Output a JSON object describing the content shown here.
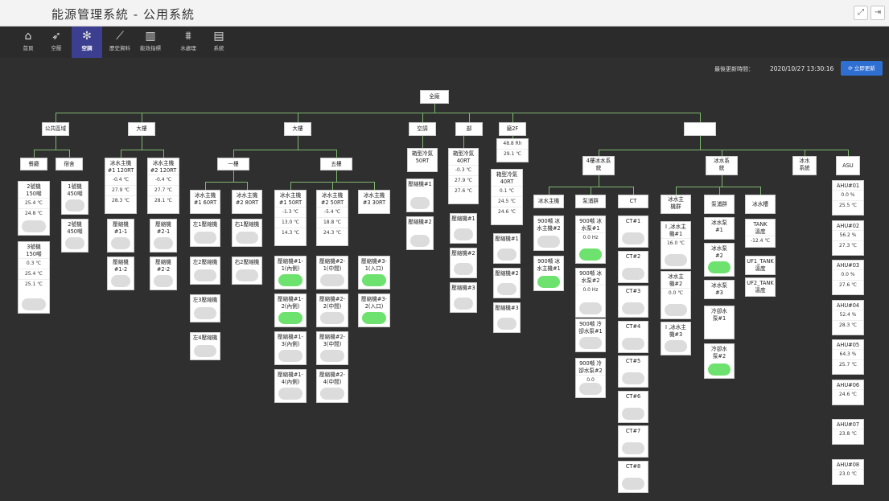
{
  "app": {
    "title": "能源管理系統 - 公用系統",
    "expand_icon": "expand-icon",
    "exit_icon": "exit-icon"
  },
  "nav": [
    {
      "label": "首頁",
      "icon": "home-icon"
    },
    {
      "label": "空壓",
      "icon": "rocket-icon"
    },
    {
      "label": "空調",
      "icon": "snowflake-icon"
    },
    {
      "label": "歷史資料",
      "icon": "line-chart-icon"
    },
    {
      "label": "能效指標",
      "icon": "bar-chart-icon"
    },
    {
      "label": "水處理",
      "icon": "water-plant-icon"
    },
    {
      "label": "系統",
      "icon": "document-icon"
    }
  ],
  "status": {
    "last_update_label": "最後更新時間：",
    "last_update_time": "2020/10/27 13:30:16",
    "refresh_label": "立即更新",
    "refresh_icon": "refresh-icon"
  },
  "colors": {
    "active_tab": "#3c3f8f",
    "on_state": "#6ee26e",
    "off_state": "#dcdcdc",
    "connector": "#7fb870",
    "refresh_button": "#2f6fd1"
  },
  "tree": {
    "root": "全廠",
    "lvl1": [
      "公共區域",
      "大樓",
      "大樓",
      "空調",
      "部",
      "廠2F",
      ""
    ],
    "public": [
      "餐廳",
      "宿舍"
    ],
    "canteen": [
      {
        "title": "2號機\n150噸",
        "vals": [
          "25.4 ℃",
          "24.8 ℃"
        ],
        "state": "off"
      },
      {
        "title": "3號機\n150噸",
        "vals": [
          "0.3 ℃",
          "25.4 ℃",
          "25.1 ℃"
        ],
        "state": "off"
      }
    ],
    "dorm": [
      {
        "title": "1號機\n450噸",
        "vals": [],
        "state": "off"
      },
      {
        "title": "2號機\n450噸",
        "vals": [],
        "state": "off"
      }
    ],
    "bldg1_chillers": [
      {
        "title": "冰水主機\n#1 120RT",
        "vals": [
          "-0.4 ℃",
          "27.9 ℃",
          "28.3 ℃"
        ]
      },
      {
        "title": "冰水主機\n#2 120RT",
        "vals": [
          "-0.4 ℃",
          "27.7 ℃",
          "28.1 ℃"
        ]
      }
    ],
    "bldg1_comp": [
      [
        "壓縮機\n#1-1",
        "壓縮機\n#1-2"
      ],
      [
        "壓縮機\n#2-1",
        "壓縮機\n#2-2"
      ]
    ],
    "bldg2_groups": [
      "一樓",
      "五樓"
    ],
    "floor1_chillers": [
      {
        "title": "冰水主機\n#1 60RT"
      },
      {
        "title": "冰水主機\n#2 80RT"
      }
    ],
    "floor1_comp": [
      [
        "左1壓縮機",
        "左2壓縮機",
        "左3壓縮機",
        "左4壓縮機"
      ],
      [
        "右1壓縮機",
        "右2壓縮機"
      ]
    ],
    "floor5_chillers": [
      {
        "title": "冰水主機\n#1 50RT",
        "vals": [
          "-1.3 ℃",
          "13.0 ℃",
          "14.3 ℃"
        ]
      },
      {
        "title": "冰水主機\n#2 50RT",
        "vals": [
          "-5.4 ℃",
          "18.8 ℃",
          "24.3 ℃"
        ]
      },
      {
        "title": "冰水主機\n#3 30RT",
        "vals": []
      }
    ],
    "floor5_comp": [
      [
        {
          "title": "壓縮機#1-\n1(內側)",
          "state": "on"
        },
        {
          "title": "壓縮機#1-\n2(內側)",
          "state": "on"
        },
        {
          "title": "壓縮機#1-\n3(內側)",
          "state": "off"
        },
        {
          "title": "壓縮機#1-\n4(內側)",
          "state": "off"
        }
      ],
      [
        {
          "title": "壓縮機#2-\n1(中間)",
          "state": "off"
        },
        {
          "title": "壓縮機#2-\n2(中間)",
          "state": "off"
        },
        {
          "title": "壓縮機#2-\n3(中間)",
          "state": "off"
        },
        {
          "title": "壓縮機#2-\n4(中間)",
          "state": "off"
        }
      ],
      [
        {
          "title": "壓縮機#3-\n1(入口)",
          "state": "on"
        },
        {
          "title": "壓縮機#3-\n2(入口)",
          "state": "on"
        }
      ]
    ],
    "ac": {
      "title": "箱型冷氣\n50RT",
      "comps": [
        "壓縮機#1",
        "壓縮機#2"
      ]
    },
    "dept": {
      "title": "箱型冷氣\n40RT",
      "vals": [
        "-0.3 ℃",
        "27.9 ℃",
        "27.6 ℃"
      ],
      "comps": [
        "壓縮機#1",
        "壓縮機#2",
        "壓縮機#3"
      ]
    },
    "f2": {
      "vals": [
        "48.8 Rh",
        "29.1 ℃"
      ],
      "unit": {
        "title": "箱型冷氣\n40RT",
        "vals": [
          "0.1 ℃",
          "24.5 ℃",
          "24.6 ℃"
        ]
      },
      "comps": [
        "壓縮機#1",
        "壓縮機#2",
        "壓縮機#3"
      ]
    },
    "last_groups": [
      "4樓冰水系\n統",
      "冰水系\n統",
      "冰水\n系統",
      "ASU"
    ],
    "f4_groups": [
      "冰水主機",
      "泵浦群",
      "CT"
    ],
    "f4_chillers": [
      {
        "title": "900噸 冰\n水主機#2",
        "state": "off"
      },
      {
        "title": "900噸 冰\n水主機#1",
        "state": "on"
      }
    ],
    "f4_pumps": [
      {
        "title": "900噸 冰\n水泵#1",
        "vals": [
          "0.0 Hz"
        ],
        "state": "on"
      },
      {
        "title": "900噸 冰\n水泵#2",
        "vals": [
          "0.0 Hz"
        ],
        "state": "off"
      },
      {
        "title": "900噸 冷\n卻水泵#1",
        "vals": [],
        "state": "off"
      },
      {
        "title": "900噸 冷\n卻水泵#2",
        "vals": [
          "0.0"
        ],
        "state": "off"
      }
    ],
    "f4_ct": [
      "CT#1",
      "CT#2",
      "CT#3",
      "CT#4",
      "CT#5",
      "CT#6",
      "CT#7",
      "CT#8"
    ],
    "cw_groups": [
      "冰水主\n機群",
      "泵浦群",
      "冰水槽"
    ],
    "cw_chillers": [
      {
        "title": "I ,冰水主\n機#1",
        "vals": [
          "16.0 ℃"
        ]
      },
      {
        "title": "冰水主\n機#2",
        "vals": [
          "0.0 ℃"
        ]
      },
      {
        "title": "I ,冰水主\n機#3",
        "vals": []
      }
    ],
    "cw_pumps": [
      {
        "title": "冰水泵\n#1",
        "state": "off"
      },
      {
        "title": "冰水泵\n#2",
        "state": "on"
      },
      {
        "title": "冰水泵\n#3",
        "state": "off"
      },
      {
        "title": "冷卻水\n泵#1",
        "state": "off"
      },
      {
        "title": "冷卻水\n泵#2",
        "state": "on"
      }
    ],
    "cw_tanks": [
      {
        "title": "TANK\n溫度",
        "vals": [
          "-12.4 ℃"
        ]
      },
      {
        "title": "UF1_TANK\n溫度",
        "vals": []
      },
      {
        "title": "UF2_TANK\n溫度",
        "vals": []
      }
    ],
    "ahu": [
      {
        "title": "AHU#01",
        "vals": [
          "0.0 %",
          "25.5 ℃"
        ]
      },
      {
        "title": "AHU#02",
        "vals": [
          "56.2 %",
          "27.3 ℃"
        ]
      },
      {
        "title": "AHU#03",
        "vals": [
          "0.0 %",
          "27.6 ℃"
        ]
      },
      {
        "title": "AHU#04",
        "vals": [
          "52.4 %",
          "28.3 ℃"
        ]
      },
      {
        "title": "AHU#05",
        "vals": [
          "64.3 %",
          "25.7 ℃"
        ]
      },
      {
        "title": "AHU#06",
        "vals": [
          "24.6 ℃"
        ]
      },
      {
        "title": "AHU#07",
        "vals": [
          "23.8 ℃"
        ]
      },
      {
        "title": "AHU#08",
        "vals": [
          "23.0 ℃"
        ]
      }
    ]
  }
}
